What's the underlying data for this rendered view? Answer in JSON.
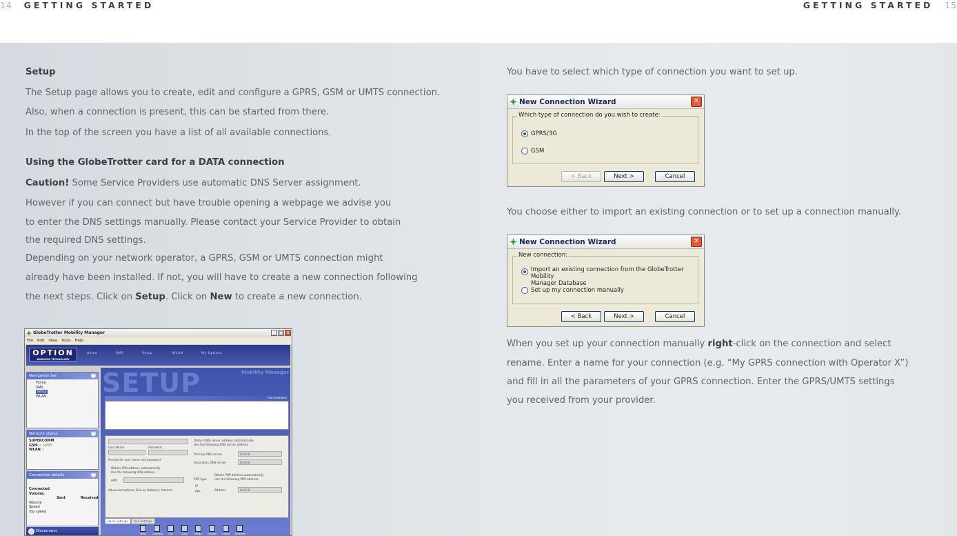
{
  "header": {
    "left_page_number": "14",
    "left_title": "GETTING STARTED",
    "right_title": "GETTING STARTED",
    "right_page_number": "15"
  },
  "left": {
    "setup_heading": "Setup",
    "setup_p1_line1": "The Setup page allows you to create, edit and configure a GPRS, GSM or UMTS connection.",
    "setup_p1_line2": "Also, when a connection is present, this can be started from there.",
    "setup_p2": "In the top of the screen you have a list of all available connections.",
    "data_heading": "Using the GlobeTrotter card for a DATA connection",
    "caution_label": "Caution!",
    "caution_line1": " Some Service Providers use automatic DNS Server assignment.",
    "caution_line2": "However if you can connect but have trouble opening a webpage we advise you",
    "caution_line3": "to enter the DNS settings manually. Please contact your Service Provider to obtain",
    "caution_line4": "the required DNS settings.",
    "dep_line1": "Depending on your network operator, a GPRS, GSM or UMTS connection might",
    "dep_line2": "already have been installed. If not, you will have to create a new connection following",
    "dep_line3_a": "the next steps. Click on ",
    "dep_line3_setup": "Setup",
    "dep_line3_b": ". Click on ",
    "dep_line3_new": "New",
    "dep_line3_c": " to create a new connection."
  },
  "screenshot": {
    "window_title": "GlobeTrotter Mobility Manager",
    "menu": "File  Edit  View  Tools  Help",
    "logo": "OPTION",
    "logo_sub": "WIRELESS TECHNOLOGY",
    "nav": [
      "Home",
      "SMS",
      "Setup",
      "WLAN",
      "My Options"
    ],
    "big_title": "SETUP",
    "brand_watermark": "Mobility Manager",
    "connections_label": "Connections",
    "navigation_bar": {
      "title": "Navigation bar",
      "items": [
        "Home",
        "SMS",
        "Setup",
        "WLAN"
      ]
    },
    "network_status": {
      "title": "Network status",
      "operator": "SUPERCOMM",
      "gsm": "GSM",
      "wlan": "WLAN",
      "gprs": "GPRS"
    },
    "connection_details": {
      "title": "Connection details",
      "connected": "Connected",
      "volume": "Volume:",
      "sent": "Sent",
      "received": "Received",
      "row_volume": "Volume",
      "row_speed": "Speed",
      "row_top_speed": "Top speed"
    },
    "form": {
      "user_name": "User Name",
      "password": "Password",
      "prompt": "Prompt for user name and password",
      "apn_auto": "Obtain APN address automatically",
      "apn_manual": "Use the following APN address",
      "apn": "APN",
      "advanced": "Advanced options: Dial-up Network, Internet",
      "dns_auto": "Obtain DNS server address automatically",
      "dns_manual": "Use the following DNS server address",
      "primary_dns": "Primary DNS server",
      "secondary_dns": "Secondary DNS server",
      "pdp_type": "PDP type",
      "pdp_auto": "Obtain PDP address automatically",
      "pdp_manual": "Use the following PDP address",
      "ip": "IP",
      "ppp": "PPP",
      "address": "Address",
      "zero_ip": "0.0.0.0"
    },
    "tabs": [
      "Basic Settings",
      "QoS Settings"
    ],
    "tools": [
      "New",
      "Connect",
      "Cut",
      "Copy",
      "Paste",
      "Delete",
      "Clone",
      "Rename"
    ],
    "disconnect": "Disconnect"
  },
  "right": {
    "intro1": "You have to select which type of connection you want to set up.",
    "intro2": "You choose either to import an existing connection or to set up a connection manually.",
    "final_line1_a": "When you set up your connection manually ",
    "final_line1_right": "right",
    "final_line1_b": "-click on the connection and select",
    "final_line2": "rename. Enter a name for your connection (e.g. “My GPRS connection with Operator X”)",
    "final_line3": "and fill in all the parameters of your GPRS connection. Enter the GPRS/UMTS settings",
    "final_line4": "you received from your provider."
  },
  "wizard1": {
    "title": "New Connection Wizard",
    "group_label": "Which type of connection do you wish to create:",
    "option1": "GPRS/3G",
    "option2": "GSM",
    "back": "< Back",
    "next": "Next >",
    "cancel": "Cancel"
  },
  "wizard2": {
    "title": "New Connection Wizard",
    "group_label": "New connection:",
    "option1_line1": "Import an existing connection from the GlobeTrotter Mobility",
    "option1_line2": "Manager Database",
    "option2": "Set up my connection manually",
    "back": "< Back",
    "next": "Next >",
    "cancel": "Cancel"
  },
  "colors": {
    "heading": "#3b4046",
    "body_text": "#5f646b",
    "page_number": "#a7b4bd",
    "left_panel": "#d4dadf",
    "right_panel": "#e6e9ec"
  }
}
